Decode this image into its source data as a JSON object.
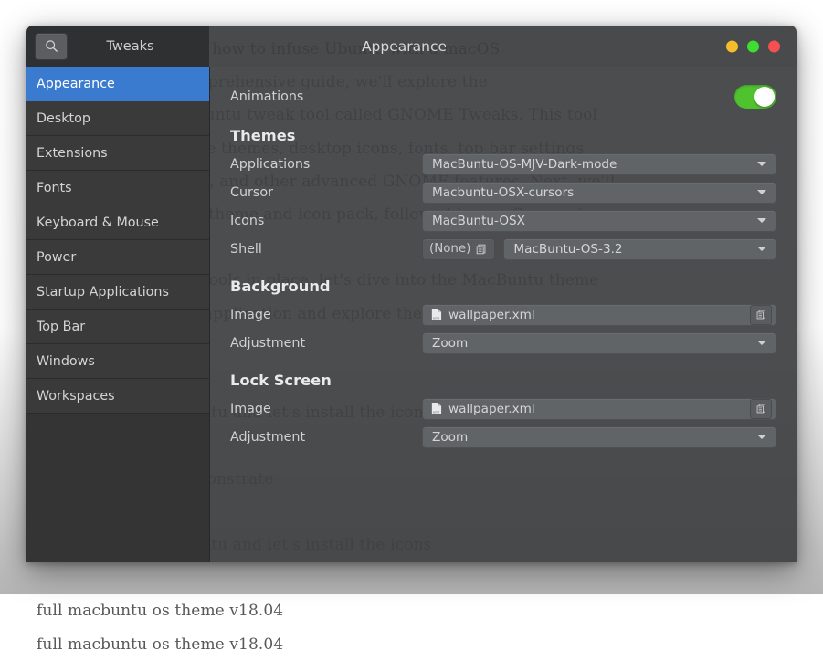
{
  "backdrop": {
    "text": "I describe in depth of how to infuse Ubuntu with a macOS\naesthetic. In this comprehensive guide, we'll explore the\ninstallation of the Ubuntu tweak tool called GNOME Tweaks. This tool\nallows us to customize themes, desktop icons, fonts, top bar settings,\nwindows, workspaces, and other advanced GNOME features. Next, we'll\ninstall the MacBuntu theme and icon pack, followed by a software store app.\n\nWith these essential tools in place, let's dive into the MacBuntu theme\nand icon installation application and explore the available\ncustomizations.\n\nppa:noobslab/macbuntu and let's install the icons\n\nThis tutorial will demonstrate\n\nppa:noobslab/macbuntu and let's install the icons\n\nfull macbuntu os theme v18.04\nfull macbuntu os theme v18.04"
  },
  "window": {
    "header": {
      "search_icon": "search-icon",
      "sidebar_title": "Tweaks",
      "page_title": "Appearance",
      "controls": [
        {
          "name": "minimize",
          "color": "#f5bc2b"
        },
        {
          "name": "maximize",
          "color": "#3fdd32"
        },
        {
          "name": "close",
          "color": "#f45050"
        }
      ]
    },
    "sidebar": {
      "selected": "Appearance",
      "items": [
        {
          "label": "Appearance",
          "selected": true
        },
        {
          "label": "Desktop",
          "selected": false
        },
        {
          "label": "Extensions",
          "selected": false
        },
        {
          "label": "Fonts",
          "selected": false
        },
        {
          "label": "Keyboard & Mouse",
          "selected": false
        },
        {
          "label": "Power",
          "selected": false
        },
        {
          "label": "Startup Applications",
          "selected": false
        },
        {
          "label": "Top Bar",
          "selected": false
        },
        {
          "label": "Windows",
          "selected": false
        },
        {
          "label": "Workspaces",
          "selected": false
        }
      ]
    },
    "content": {
      "animations": {
        "label": "Animations",
        "toggle_on": true,
        "toggle_color": "#4fc22e"
      },
      "themes": {
        "heading": "Themes",
        "applications": {
          "label": "Applications",
          "value": "MacBuntu-OS-MJV-Dark-mode"
        },
        "cursor": {
          "label": "Cursor",
          "value": "Macbuntu-OSX-cursors"
        },
        "icons": {
          "label": "Icons",
          "value": "MacBuntu-OSX"
        },
        "shell": {
          "label": "Shell",
          "none_button": "(None)",
          "none_icon": "documents-icon",
          "value": "MacBuntu-OS-3.2"
        }
      },
      "background": {
        "heading": "Background",
        "image": {
          "label": "Image",
          "value": "wallpaper.xml",
          "file_icon": "xml-file-icon",
          "action_icon": "documents-icon"
        },
        "adjustment": {
          "label": "Adjustment",
          "value": "Zoom"
        }
      },
      "lock_screen": {
        "heading": "Lock Screen",
        "image": {
          "label": "Image",
          "value": "wallpaper.xml",
          "file_icon": "xml-file-icon",
          "action_icon": "documents-icon"
        },
        "adjustment": {
          "label": "Adjustment",
          "value": "Zoom"
        }
      }
    },
    "colors": {
      "sidebar_bg": "#343434",
      "content_bg": "#3e4042",
      "selection_blue": "#3a7bd0",
      "combo_bg": "#616467"
    }
  }
}
